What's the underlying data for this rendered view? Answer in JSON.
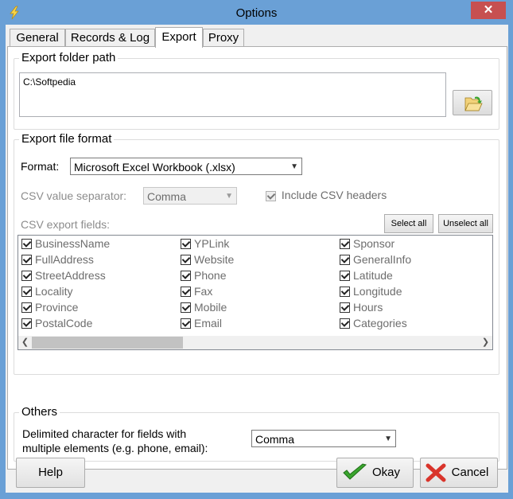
{
  "window": {
    "title": "Options",
    "close_glyph": "✕"
  },
  "tabs": [
    {
      "label": "General"
    },
    {
      "label": "Records & Log"
    },
    {
      "label": "Export"
    },
    {
      "label": "Proxy"
    }
  ],
  "active_tab": "Export",
  "export_folder": {
    "label": "Export folder path",
    "path": "C:\\Softpedia",
    "browse_icon": "folder-open-icon"
  },
  "export_format": {
    "group_label": "Export file format",
    "format_label": "Format:",
    "format_value": "Microsoft Excel Workbook (.xlsx)",
    "csv_separator_label": "CSV value separator:",
    "csv_separator_value": "Comma",
    "include_headers_label": "Include CSV headers",
    "include_headers_checked": true,
    "csv_fields_label": "CSV export fields:",
    "select_all_label": "Select all",
    "unselect_all_label": "Unselect all",
    "fields": [
      [
        "BusinessName",
        "FullAddress",
        "StreetAddress",
        "Locality",
        "Province",
        "PostalCode"
      ],
      [
        "YPLink",
        "Website",
        "Phone",
        "Fax",
        "Mobile",
        "Email"
      ],
      [
        "Sponsor",
        "GeneralInfo",
        "Latitude",
        "Longitude",
        "Hours",
        "Categories"
      ]
    ]
  },
  "others": {
    "group_label": "Others",
    "delim_label_line1": "Delimited character for fields with",
    "delim_label_line2": "multiple elements (e.g. phone, email):",
    "delim_value": "Comma"
  },
  "buttons": {
    "help": "Help",
    "okay": "Okay",
    "cancel": "Cancel"
  },
  "colors": {
    "titlebar": "#6aa0d6",
    "close": "#c75050",
    "okay_check": "#3aa52e",
    "cancel_x": "#d9342b"
  }
}
